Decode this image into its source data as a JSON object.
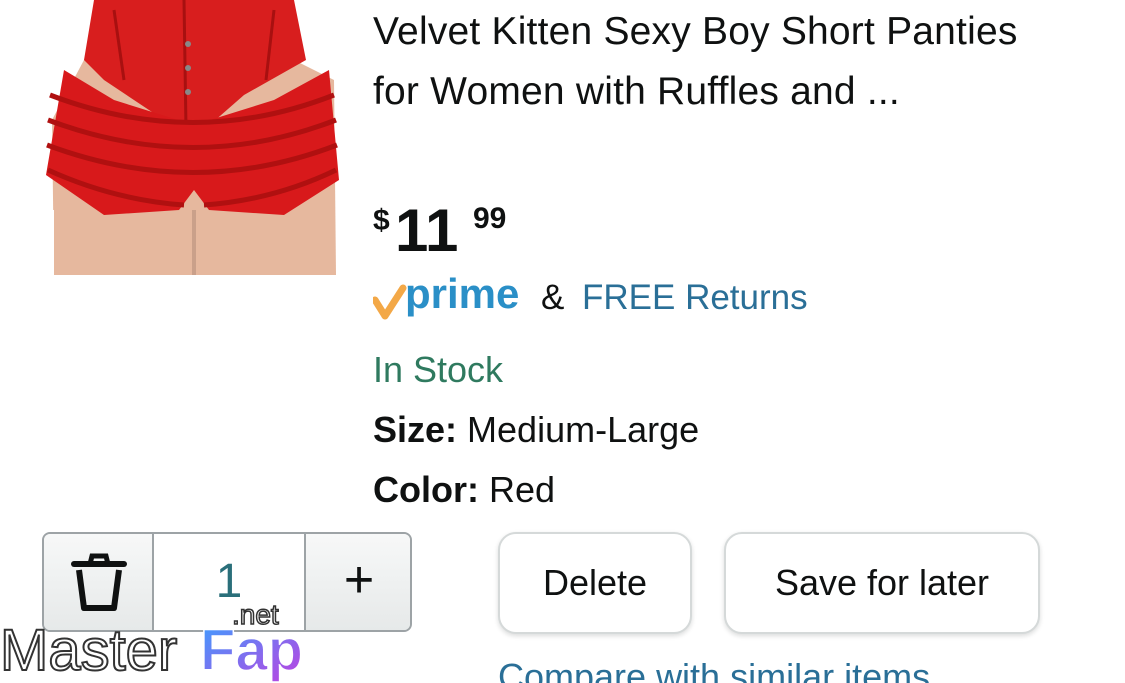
{
  "product": {
    "title": "Velvet Kitten Sexy Boy Short Panties for Women with Ruffles and ...",
    "price": {
      "symbol": "$",
      "whole": "11",
      "fraction": "99"
    },
    "prime_label": "prime",
    "amp": "&",
    "returns_label": "FREE Returns",
    "stock": "In Stock",
    "size_label": "Size:",
    "size_value": "Medium-Large",
    "color_label": "Color:",
    "color_value": "Red"
  },
  "quantity": {
    "value": "1",
    "plus": "+"
  },
  "actions": {
    "delete": "Delete",
    "save_for_later": "Save for later"
  },
  "compare_link": "Compare with similar items",
  "watermark": {
    "brand_a": "Master",
    "brand_b": "Fap",
    "suffix": ".net"
  },
  "colors": {
    "link": "#2a6f97",
    "stock": "#2f7a5f",
    "prime_check": "#f3a847",
    "prime_text": "#2a8fc7",
    "product_red": "#d81e1e"
  }
}
